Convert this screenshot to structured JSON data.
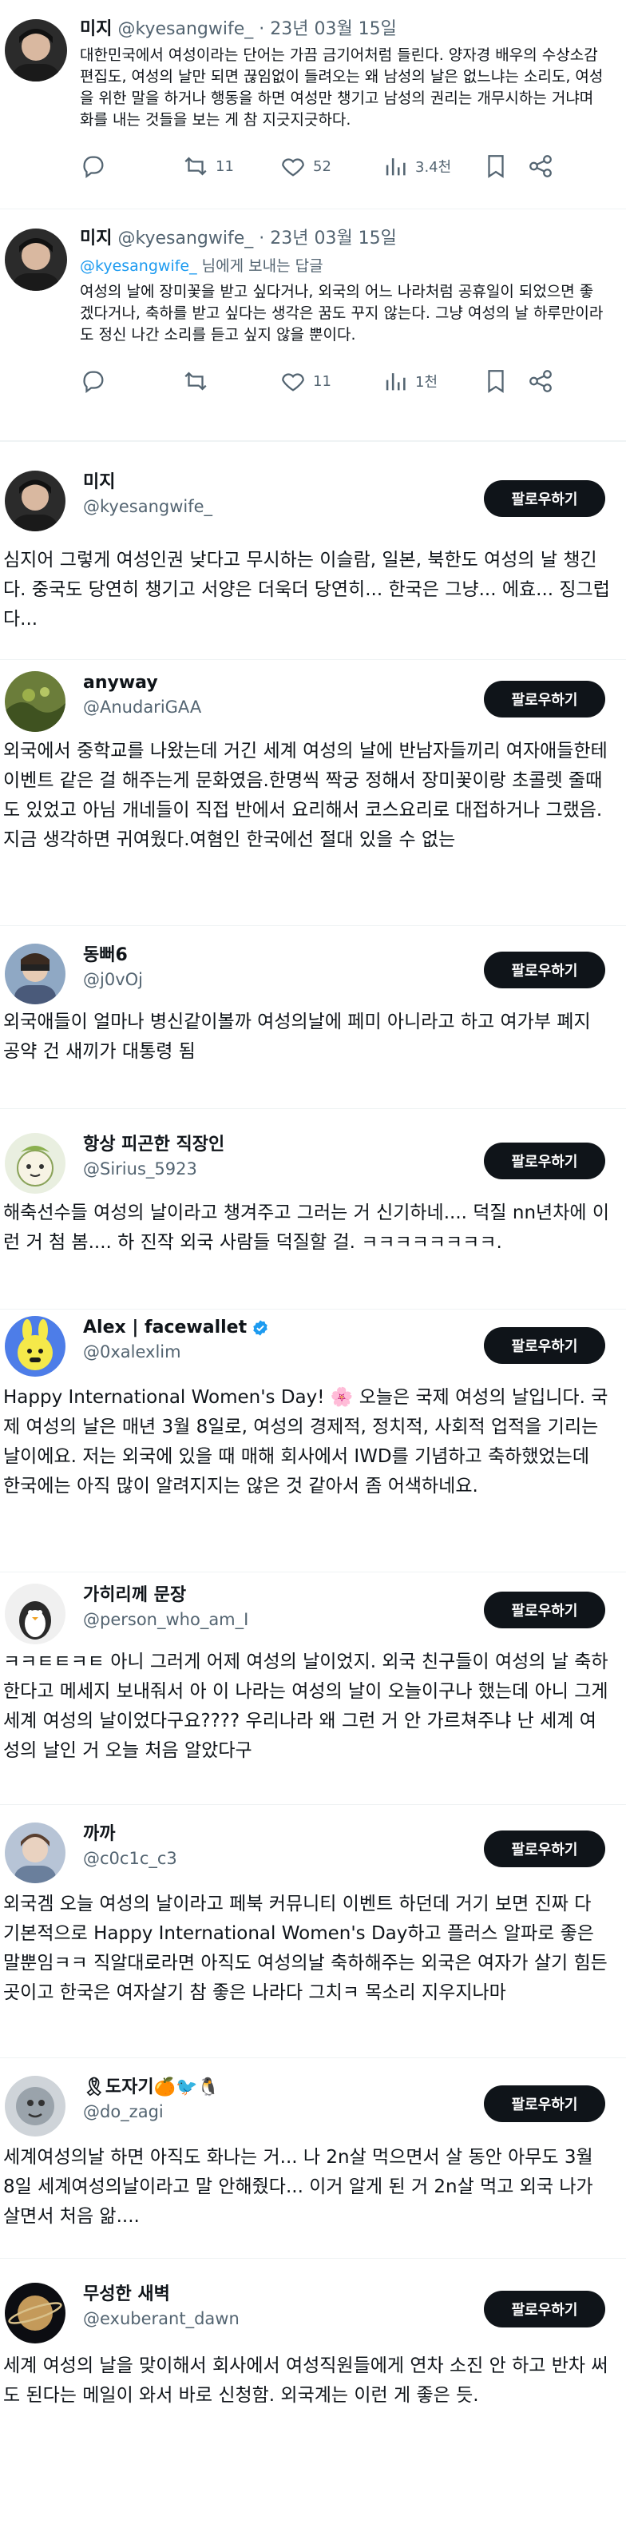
{
  "tweets": [
    {
      "name": "미지",
      "handle": "@kyesangwife_",
      "date": "· 23년 03월 15일",
      "text": "대한민국에서 여성이라는 단어는 가끔 금기어처럼 들린다. 양자경 배우의 수상소감 편집도, 여성의 날만 되면 끊임없이 들려오는 왜 남성의 날은 없느냐는 소리도, 여성을 위한 말을 하거나 행동을 하면 여성만 챙기고 남성의 권리는 개무시하는 거냐며 화를 내는 것들을 보는 게 참 지긋지긋하다.",
      "reply_count": "",
      "retweets": "11",
      "likes": "52",
      "views": "3.4천"
    },
    {
      "name": "미지",
      "handle": "@kyesangwife_",
      "date": "· 23년 03월 15일",
      "reply_to_mention": "@kyesangwife_",
      "reply_to_suffix": " 님에게 보내는 답글",
      "text": "여성의 날에 장미꽃을 받고 싶다거나, 외국의 어느 나라처럼 공휴일이 되었으면 좋겠다거나, 축하를 받고 싶다는 생각은 꿈도 꾸지 않는다. 그냥 여성의 날 하루만이라도 정신 나간 소리를 듣고 싶지 않을 뿐이다.",
      "reply_count": "",
      "retweets": "",
      "likes": "11",
      "views": "1천"
    }
  ],
  "follow_label": "팔로우하기",
  "users": [
    {
      "name": "미지",
      "handle": "@kyesangwife_",
      "bio": "심지어 그렇게 여성인권 낮다고 무시하는 이슬람, 일본, 북한도 여성의 날 챙긴다. 중국도 당연히 챙기고 서양은 더욱더 당연히... 한국은 그냥... 에효... 징그럽다..."
    },
    {
      "name": "anyway",
      "handle": "@AnudariGAA",
      "bio": "외국에서 중학교를 나왔는데 거긴 세계 여성의 날에 반남자들끼리 여자애들한테 이벤트 같은 걸 해주는게 문화였음.한명씩 짝궁 정해서 장미꽃이랑 초콜렛 줄때도 있었고 아님 개네들이 직접 반에서 요리해서 코스요리로 대접하거나 그랬음.지금 생각하면 귀여웠다.여혐인 한국에선 절대 있을 수 없는"
    },
    {
      "name": "동뻐6",
      "handle": "@j0vOj",
      "bio": "외국애들이 얼마나 병신같이볼까 여성의날에 페미 아니라고 하고 여가부 폐지 공약 건 새끼가 대통령 됨"
    },
    {
      "name": "항상 피곤한 직장인",
      "handle": "@Sirius_5923",
      "bio": "해축선수들 여성의 날이라고 챙겨주고 그러는 거 신기하네.... 덕질 nn년차에 이런 거 첨 봄.... 하 진작 외국 사람들 덕질할 걸. ㅋㅋㅋㅋㅋㅋㅋㅋ."
    },
    {
      "name": "Alex | facewallet",
      "handle": "@0xalexlim",
      "verified": true,
      "bio": "Happy International Women's Day! 🌸 오늘은 국제 여성의 날입니다. 국제 여성의 날은 매년 3월 8일로, 여성의 경제적, 정치적, 사회적 업적을 기리는 날이에요. 저는 외국에 있을 때 매해 회사에서 IWD를 기념하고 축하했었는데 한국에는 아직 많이 알려지지는 않은 것 같아서 좀 어색하네요."
    },
    {
      "name": "가히리께 문장",
      "handle": "@person_who_am_I",
      "bio": "ㅋㅋㅌㅌㅋㅌ 아니 그러게 어제 여성의 날이었지. 외국 친구들이 여성의 날 축하한다고 메세지 보내줘서 아 이 나라는 여성의 날이 오늘이구나 했는데 아니 그게 세계 여성의 날이었다구요???? 우리나라 왜 그런 거 안 가르쳐주냐 난 세계 여성의 날인 거 오늘 처음 알았다구"
    },
    {
      "name": "까까",
      "handle": "@c0c1c_c3",
      "bio": "외국겜 오늘 여성의 날이라고 페북 커뮤니티 이벤트 하던데 거기 보면 진짜 다 기본적으로 Happy International Women's Day하고 플러스 알파로 좋은말뿐임ㅋㅋ 직알대로라면 아직도 여성의날 축하해주는 외국은 여자가 살기 힘든 곳이고 한국은 여자살기 참 좋은 나라다 그치ㅋ 목소리 지우지나마"
    },
    {
      "name": "🎗도자기🍊🐦🐧",
      "handle": "@do_zagi",
      "bio": "세계여성의날 하면 아직도 화나는 거... 나 2n살 먹으면서 살 동안 아무도 3월 8일 세계여성의날이라고 말 안해줬다... 이거 알게 된 거 2n살 먹고 외국 나가 살면서 처음 앎...."
    },
    {
      "name": "무성한 새벽",
      "handle": "@exuberant_dawn",
      "bio": "세계 여성의 날을 맞이해서 회사에서 여성직원들에게 연차 소진 안 하고 반차 써도 된다는 메일이 와서 바로 신청함. 외국계는 이런 게 좋은 듯."
    }
  ]
}
